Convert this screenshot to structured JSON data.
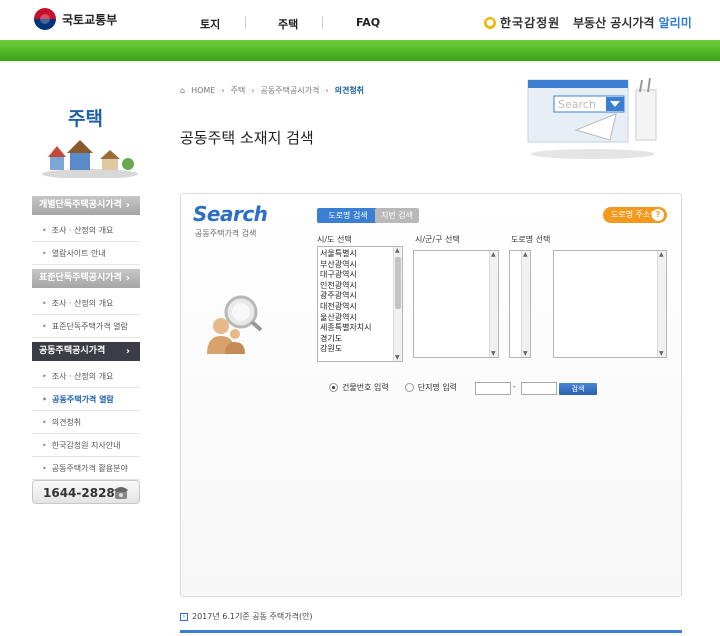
{
  "header": {
    "logo_text": "국토교통부",
    "nav": [
      "토지",
      "주택",
      "FAQ"
    ],
    "agency_name": "한국감정원",
    "site_title_prefix": "부동산 공시가격 ",
    "site_title_accent": "알리미"
  },
  "colors": {
    "brand_green": "#3aa31a",
    "accent_blue": "#2d7ad6",
    "help_orange": "#f39a1e"
  },
  "sidebar": {
    "title": "주택",
    "groups": [
      {
        "label": "개별단독주택공시가격",
        "active": false,
        "items": [
          "조사 · 산정의 개요",
          "열람사이트 안내"
        ]
      },
      {
        "label": "표준단독주택공시가격",
        "active": false,
        "items": [
          "조사 · 산정의 개요",
          "표준단독주택가격 열람"
        ]
      },
      {
        "label": "공동주택공시가격",
        "active": true,
        "items": [
          "조사 · 산정의 개요",
          "공동주택가격 열람",
          "의견청취",
          "한국감정원 지사안내",
          "공동주택가격 활용분야"
        ]
      }
    ],
    "current_item": "공동주택가격 열람",
    "phone": "1644-2828"
  },
  "breadcrumb": [
    "HOME",
    "주택",
    "공동주택공시가격",
    "의견청취"
  ],
  "page_title": "공동주택 소재지 검색",
  "search_graphic_label": "Search",
  "panel": {
    "logo": "Search",
    "subtitle": "공동주택가격 검색",
    "tab_road": "도로명 검색",
    "tab_lot": "지번 검색",
    "help_label": "도로명 주소란",
    "col_city": "시/도 선택",
    "col_district": "시/군/구 선택",
    "col_road": "도로명 선택",
    "cities": [
      "서울특별시",
      "부산광역시",
      "대구광역시",
      "인천광역시",
      "광주광역시",
      "대전광역시",
      "울산광역시",
      "세종특별자치시",
      "경기도",
      "강원도"
    ],
    "radio_building": "건물번호 입력",
    "radio_complex": "단지명 입력",
    "search_button": "검색"
  },
  "notice": "2017년 6.1기준 공동 주택가격(안)"
}
